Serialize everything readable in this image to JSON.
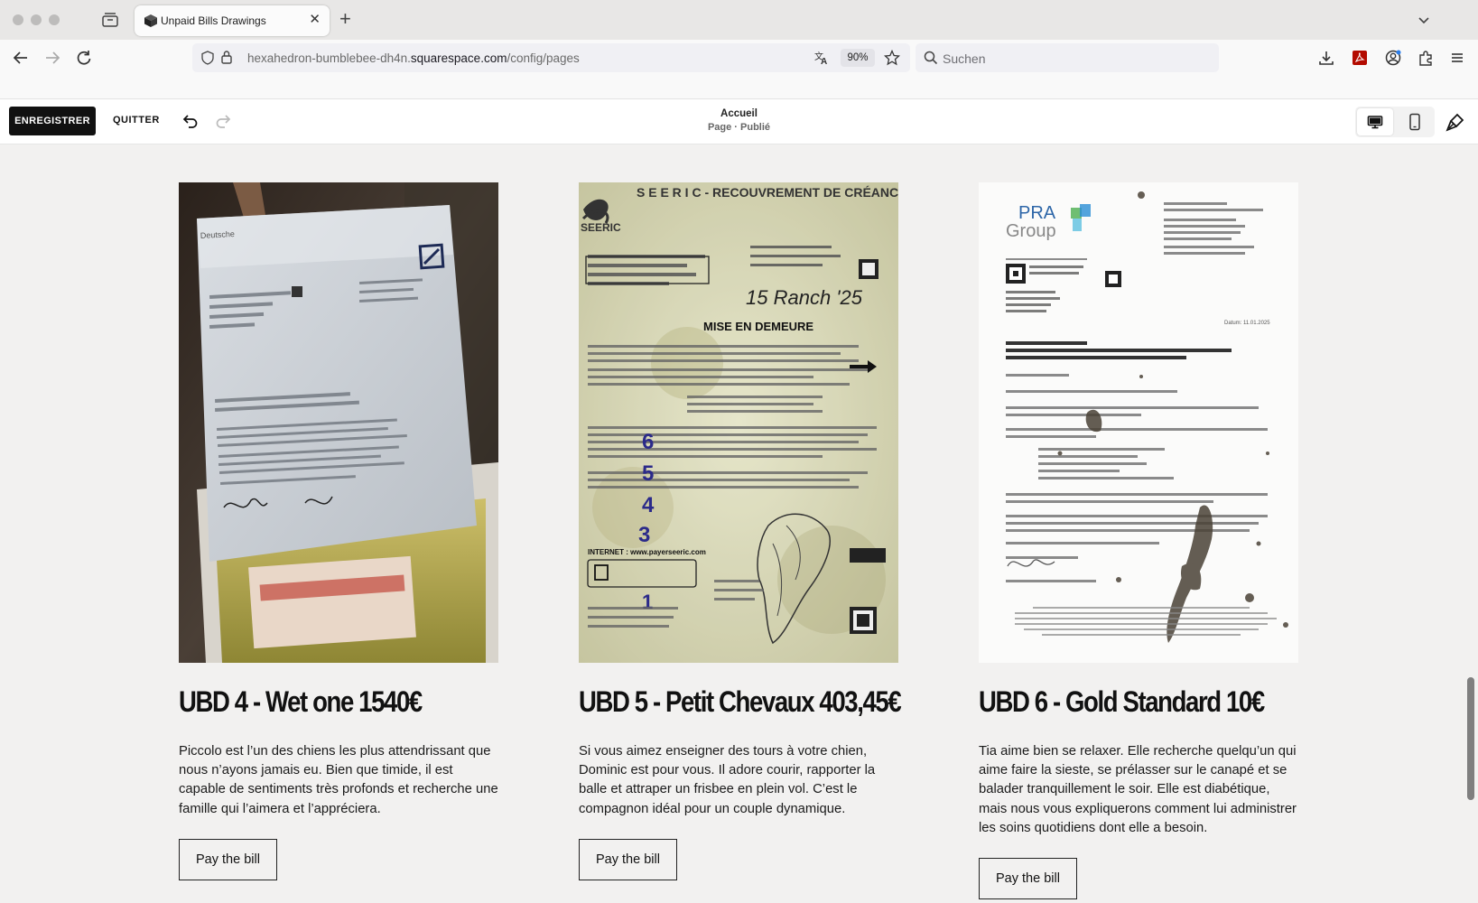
{
  "browser": {
    "tab_title": "Unpaid Bills Drawings",
    "url_host_prefix": "hexahedron-bumblebee-dh4n.",
    "url_host": "squarespace.com",
    "url_path": "/config/pages",
    "zoom": "90%",
    "search_placeholder": "Suchen"
  },
  "editor": {
    "save_label": "ENREGISTRER",
    "quit_label": "QUITTER",
    "page_title": "Accueil",
    "page_status": "Page · Publié"
  },
  "cards": [
    {
      "title": "UBD 4 - Wet one 1540€",
      "text": "Piccolo est l’un des chiens les plus attendrissant que nous n’ayons jamais eu. Bien que timide, il est capable de sentiments très profonds et recherche une famille qui l’aimera et l’appréciera.",
      "button": "Pay the bill"
    },
    {
      "title": "UBD 5 - Petit Chevaux 403,45€",
      "text": "Si vous aimez enseigner des tours à votre chien, Dominic est pour vous. Il adore courir, rapporter la balle et attraper un frisbee en plein vol. C’est le compagnon idéal pour un couple dynamique.",
      "button": "Pay the bill"
    },
    {
      "title": "UBD 6 - Gold Standard 10€",
      "text": "Tia aime bien se relaxer. Elle recherche quelqu’un qui aime faire la sieste, se prélasser sur le canapé et se balader tranquillement le soir. Elle est diabétique, mais nous vous expliquerons comment lui administrer les soins quotidiens dont elle a besoin.",
      "button": "Pay the bill"
    }
  ],
  "images": {
    "card1_letter_sender": "Deutsche",
    "card2_header": "S E E R I C - RECOUVREMENT DE CRÉANCES",
    "card2_logo": "SEERIC",
    "card2_banner": "MISE EN DEMEURE",
    "card2_handwriting": "15 Ranch '25",
    "card2_numbers": [
      "6",
      "5",
      "4",
      "3",
      "1"
    ],
    "card2_internet": "INTERNET : www.payerseeric.com",
    "card3_logo_line1": "PRA",
    "card3_logo_line2": "Group",
    "card3_date": "Datum: 11.01.2025"
  },
  "colors": {
    "save_bg": "#111111",
    "page_bg": "#f2f1f0",
    "scroll_thumb": "#7f7f7f"
  },
  "icons": [
    "back-icon",
    "forward-icon",
    "reload-icon",
    "shield-icon",
    "lock-icon",
    "translate-icon",
    "star-icon",
    "search-icon",
    "download-icon",
    "pdf-icon",
    "account-icon",
    "extensions-icon",
    "menu-icon",
    "undo-icon",
    "redo-icon",
    "desktop-icon",
    "mobile-icon",
    "design-brush-icon"
  ]
}
